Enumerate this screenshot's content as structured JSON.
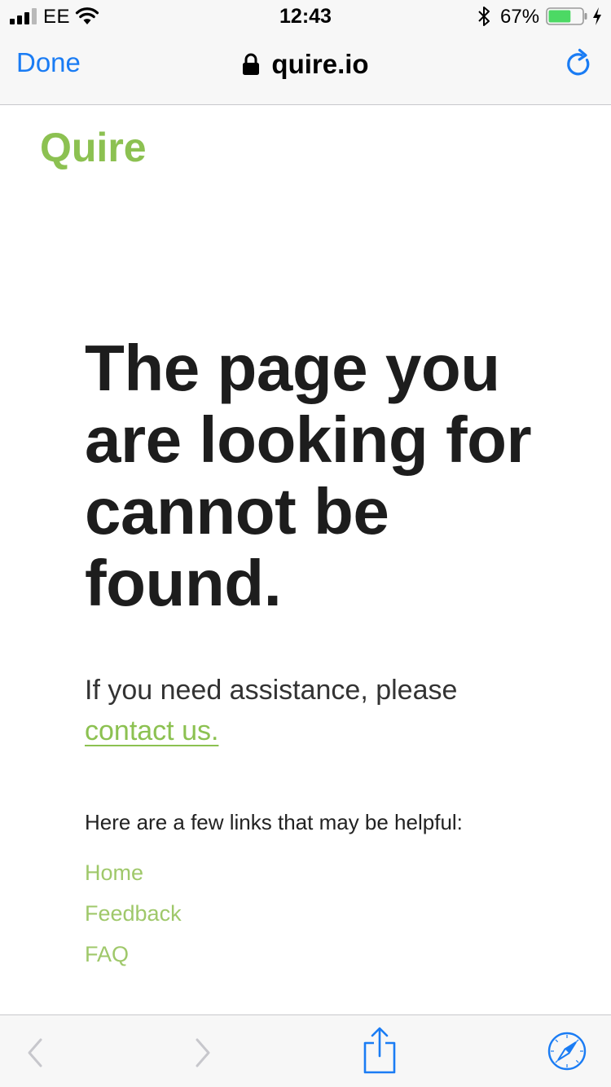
{
  "status_bar": {
    "carrier": "EE",
    "time": "12:43",
    "battery_percent": "67%",
    "battery_level": 0.67,
    "icons": [
      "signal-icon",
      "wifi-icon",
      "bluetooth-icon",
      "battery-icon",
      "charging-icon"
    ]
  },
  "nav": {
    "done_label": "Done",
    "url": "quire.io",
    "icons": [
      "lock-icon",
      "reload-icon"
    ]
  },
  "page": {
    "logo_text": "Quire",
    "headline": "The page you are looking for cannot be found.",
    "assist_text": "If you need assistance, please",
    "contact_link": "contact us.",
    "links_intro": "Here are a few links that may be helpful:",
    "links": [
      "Home",
      "Feedback",
      "FAQ"
    ]
  },
  "toolbar": {
    "icons": [
      "back-icon",
      "forward-icon",
      "share-icon",
      "safari-compass-icon"
    ]
  },
  "colors": {
    "accent_blue": "#1a7cf4",
    "brand_green": "#8cc151",
    "link_green": "#9fc86a",
    "battery_green": "#4cd964",
    "text_dark": "#1d1d1d"
  }
}
